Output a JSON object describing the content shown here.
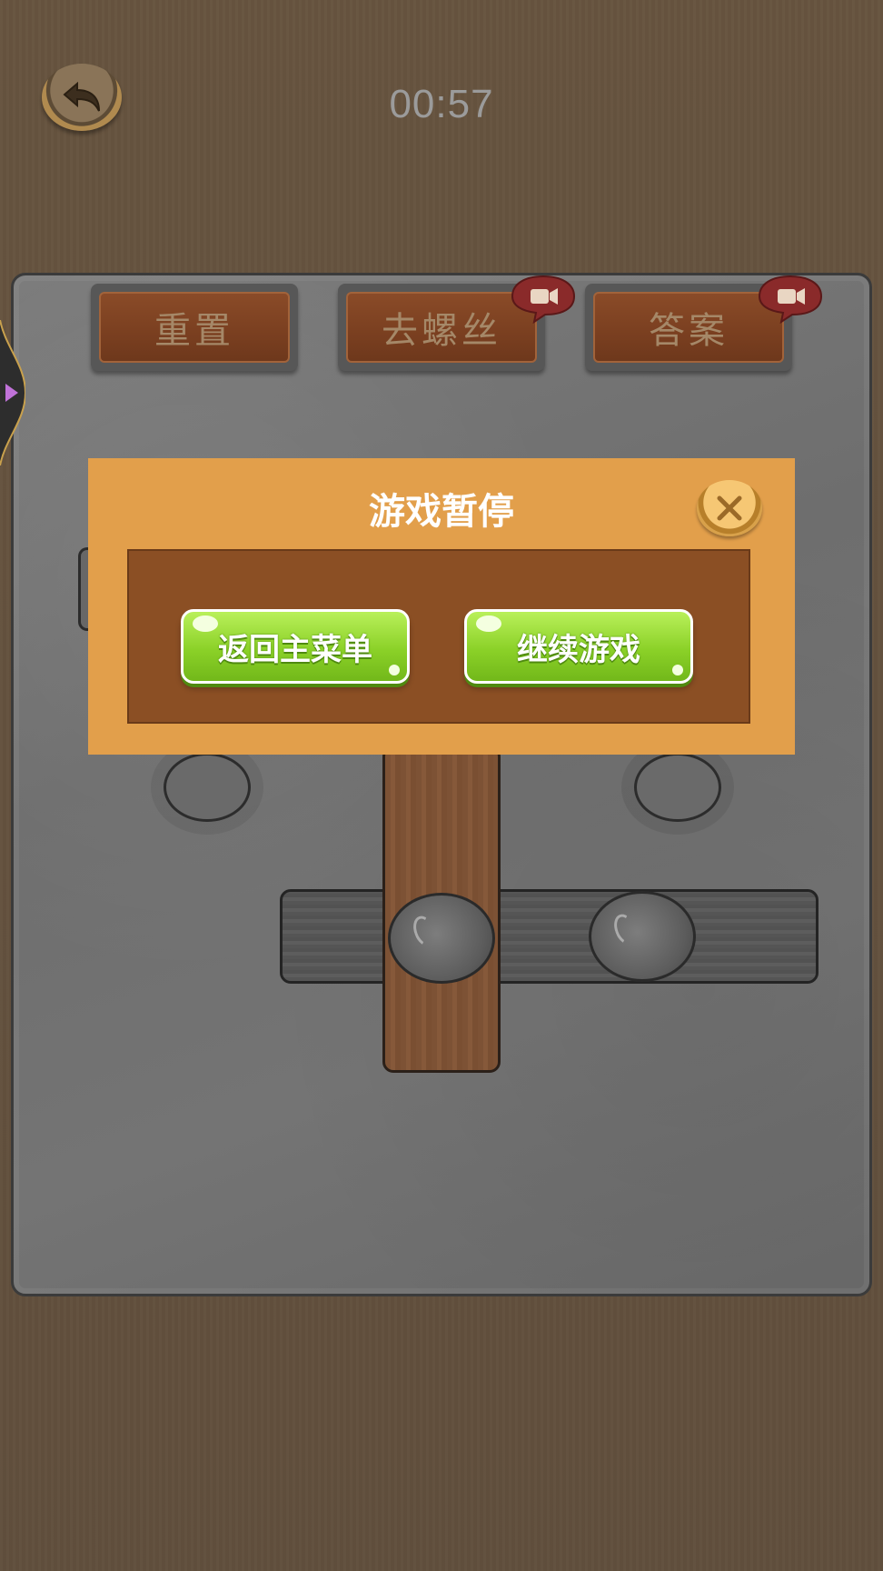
{
  "header": {
    "timer": "00:57"
  },
  "toolbar": {
    "reset_label": "重置",
    "remove_screw_label": "去螺丝",
    "answer_label": "答案"
  },
  "icons": {
    "back": "back-arrow-icon",
    "video": "video-ad-icon",
    "close": "close-icon"
  },
  "pause_dialog": {
    "title": "游戏暂停",
    "main_menu_label": "返回主菜单",
    "continue_label": "继续游戏"
  },
  "colors": {
    "background": "#655342",
    "board": "#747474",
    "dialog": "#e29f4b",
    "dialog_panel": "#8b4f24",
    "green_button": "#8bd128",
    "toolbar_button": "#7a3f20"
  }
}
